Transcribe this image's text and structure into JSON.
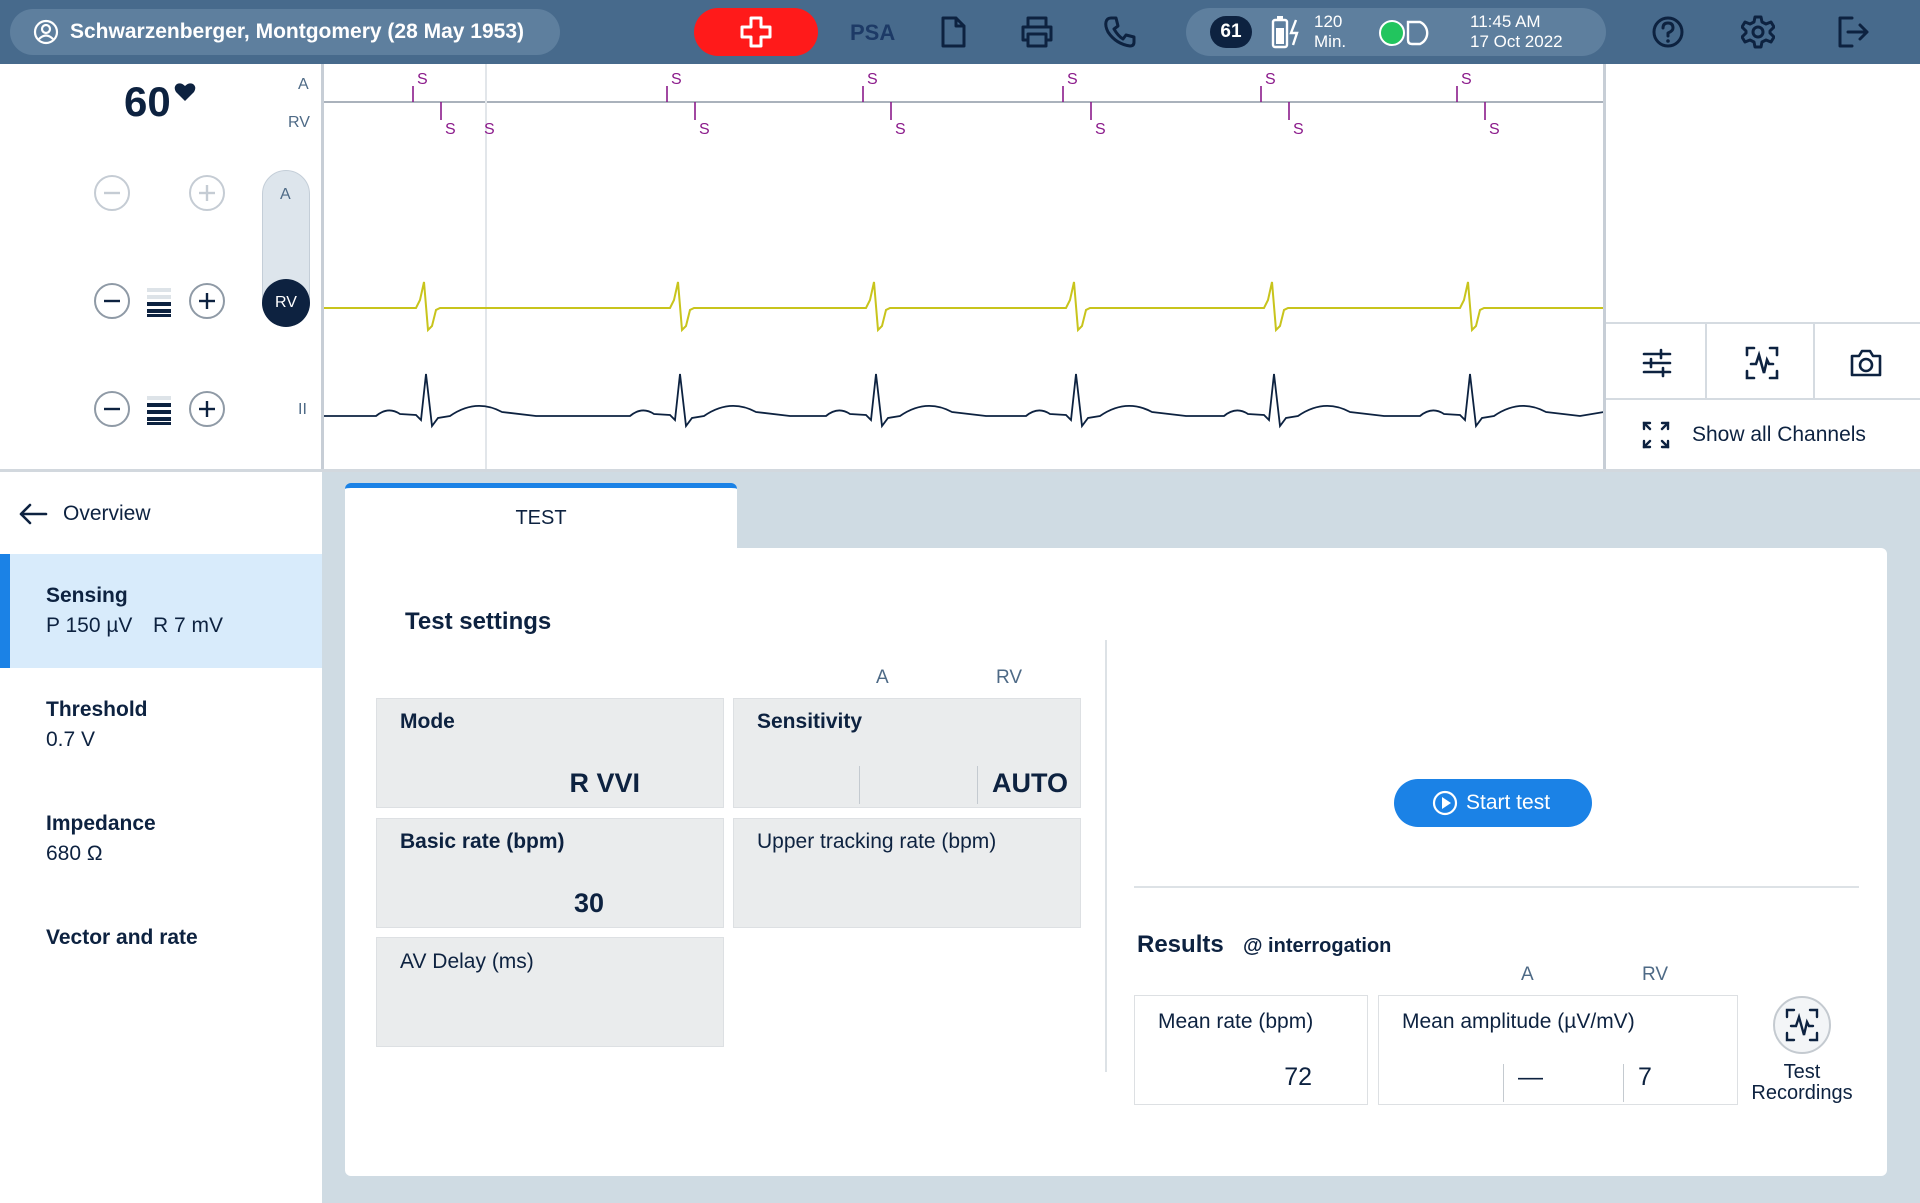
{
  "patient": {
    "name": "Schwarzenberger, Montgomery (28 May 1953)"
  },
  "topbar": {
    "psa_label": "PSA",
    "counter": "61",
    "duration_value": "120",
    "duration_unit": "Min.",
    "time": "11:45 AM",
    "date": "17 Oct 2022",
    "icons": [
      "user-icon",
      "emergency-cross-icon",
      "document-icon",
      "printer-icon",
      "phone-icon",
      "battery-icon",
      "connection-icon",
      "help-icon",
      "gear-icon",
      "logout-icon"
    ]
  },
  "ecg": {
    "heart_rate": "60",
    "channel_a": "A",
    "channel_rv": "RV",
    "selector_a": "A",
    "selector_rv": "RV",
    "lead_ii": "II",
    "marker": "S",
    "colors": {
      "rv_trace": "#c8c41c",
      "ecg_trace": "#0d2240",
      "markers": "#8b1a8b"
    }
  },
  "right_panel": {
    "show_all_channels": "Show all Channels",
    "icons": [
      "sliders-icon",
      "recording-icon",
      "camera-icon",
      "expand-icon"
    ]
  },
  "nav": {
    "back_label": "Overview",
    "items": [
      {
        "title": "Sensing",
        "sub1": "P 150 µV",
        "sub2": "R 7 mV"
      },
      {
        "title": "Threshold",
        "sub1": "0.7 V"
      },
      {
        "title": "Impedance",
        "sub1": "680 Ω"
      },
      {
        "title": "Vector and rate"
      }
    ]
  },
  "tab": {
    "label": "TEST"
  },
  "settings": {
    "title": "Test settings",
    "col_a": "A",
    "col_rv": "RV",
    "mode_label": "Mode",
    "mode_value": "R VVI",
    "sensitivity_label": "Sensitivity",
    "sensitivity_value": "AUTO",
    "basic_rate_label": "Basic rate (bpm)",
    "basic_rate_value": "30",
    "upper_tracking_label": "Upper tracking rate (bpm)",
    "av_delay_label": "AV Delay (ms)"
  },
  "test": {
    "start_label": "Start test"
  },
  "results": {
    "title": "Results",
    "subtitle": "@ interrogation",
    "col_a": "A",
    "col_rv": "RV",
    "mean_rate_label": "Mean rate (bpm)",
    "mean_rate_value": "72",
    "mean_amp_label": "Mean amplitude (µV/mV)",
    "mean_amp_a": "—",
    "mean_amp_rv": "7",
    "recordings_line1": "Test",
    "recordings_line2": "Recordings"
  },
  "colors": {
    "topbar": "#476a8c",
    "accent": "#1b82e6",
    "emergency": "#ff1a1a",
    "selected_nav": "#d8ebfb"
  }
}
